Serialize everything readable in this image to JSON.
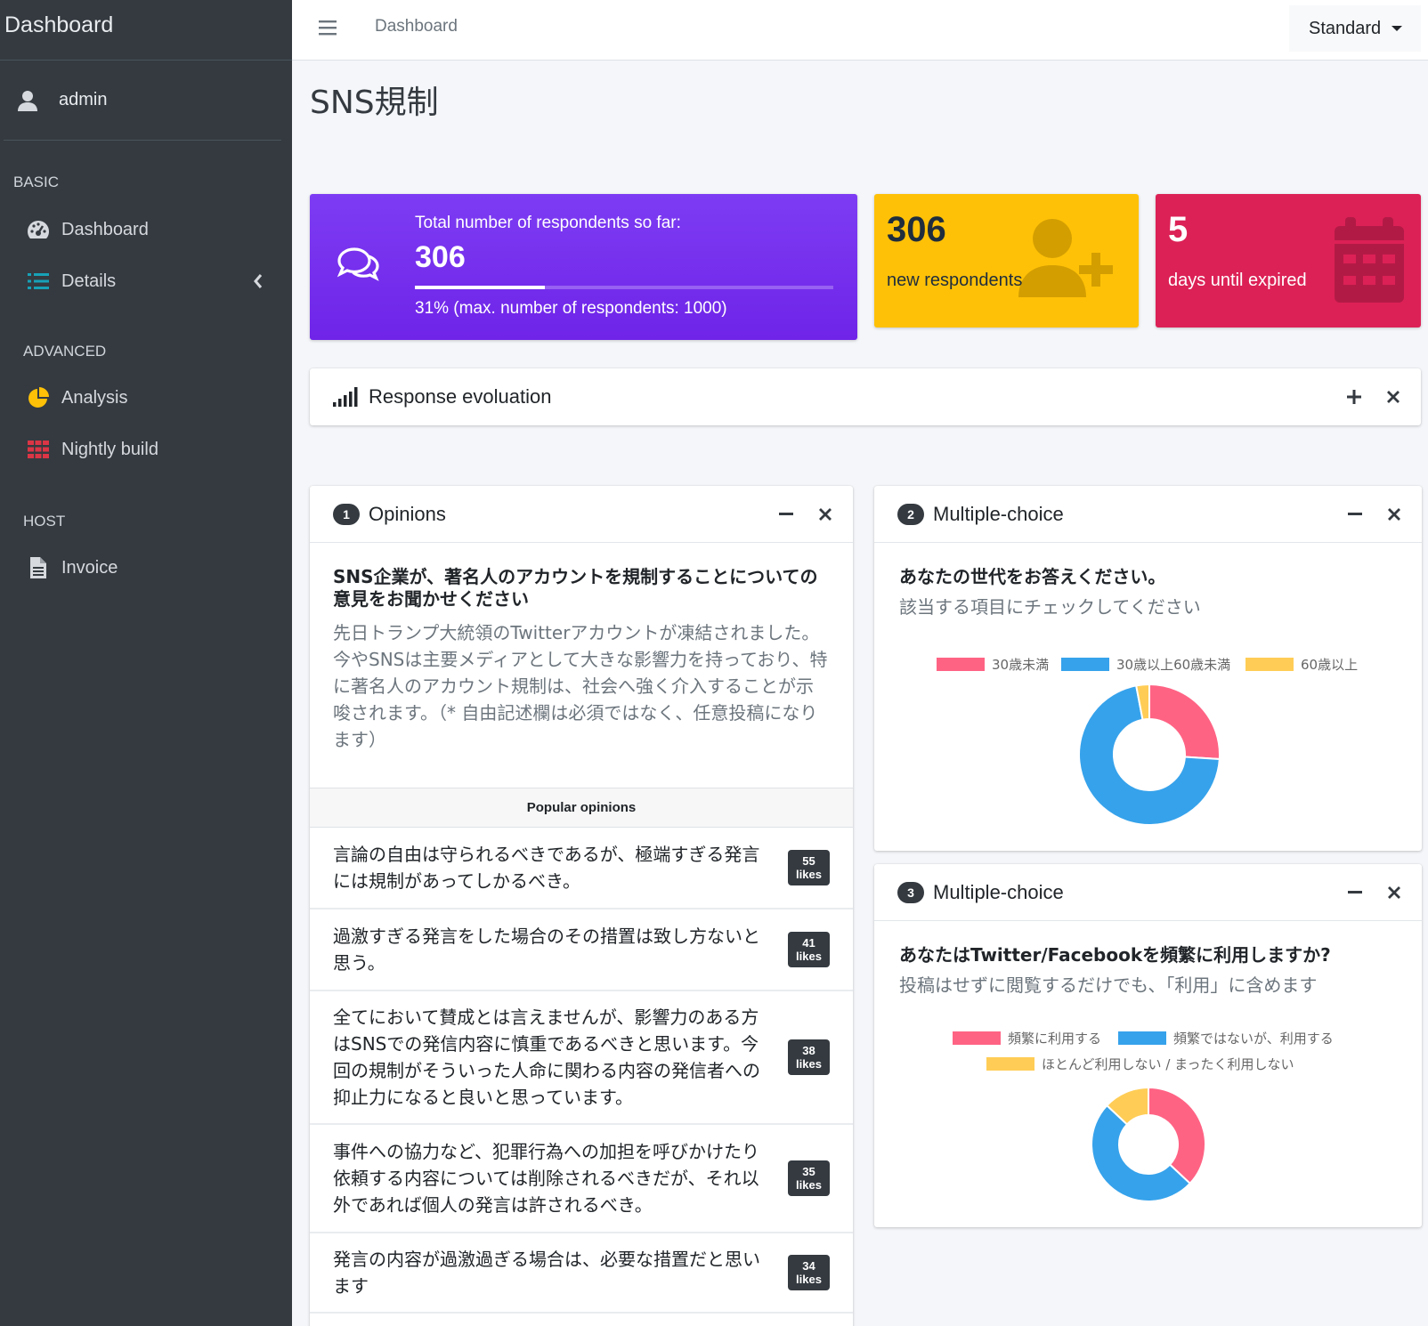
{
  "sidebar": {
    "brand": "Dashboard",
    "user": "admin",
    "sections": [
      {
        "header": "BASIC",
        "items": [
          {
            "label": "Dashboard",
            "icon": "tachometer-icon"
          },
          {
            "label": "Details",
            "icon": "list-icon"
          }
        ]
      },
      {
        "header": "ADVANCED",
        "items": [
          {
            "label": "Analysis",
            "icon": "pie-chart-icon"
          },
          {
            "label": "Nightly build",
            "icon": "grid-icon"
          }
        ]
      },
      {
        "header": "HOST",
        "items": [
          {
            "label": "Invoice",
            "icon": "file-icon"
          }
        ]
      }
    ]
  },
  "topbar": {
    "breadcrumb": "Dashboard",
    "mode": "Standard"
  },
  "page": {
    "title": "SNS規制"
  },
  "stats": {
    "total": {
      "label": "Total number of respondents so far:",
      "value": "306",
      "progress": 0.31,
      "desc": "31% (max. number of respondents: 1000)"
    },
    "new": {
      "value": "306",
      "label": "new respondents",
      "color": "#ffc107"
    },
    "expire": {
      "value": "5",
      "label": "days until expired",
      "color": "#dc2156"
    }
  },
  "response": {
    "title": "Response evoluation"
  },
  "opinions": {
    "num": "1",
    "title": "Opinions",
    "question": "SNS企業が、著名人のアカウントを規制することについての意見をお聞かせください",
    "description": "先日トランプ大統領のTwitterアカウントが凍結されました。今やSNSは主要メディアとして大きな影響力を持っており、特に著名人のアカウント規制は、社会へ強く介入することが示唆されます。（* 自由記述欄は必須ではなく、任意投稿になります）",
    "popular_header": "Popular opinions",
    "likes_label": "likes",
    "items": [
      {
        "text": "言論の自由は守られるべきであるが、極端すぎる発言には規制があってしかるべき。",
        "likes": "55"
      },
      {
        "text": "過激すぎる発言をした場合のその措置は致し方ないと思う。",
        "likes": "41"
      },
      {
        "text": "全てにおいて賛成とは言えませんが、影響力のある方はSNSでの発信内容に慎重であるべきと思います。今回の規制がそういった人命に関わる内容の発信者への抑止力になると良いと思っています。",
        "likes": "38"
      },
      {
        "text": "事件への協力など、犯罪行為への加担を呼びかけたり依頼する内容については削除されるべきだが、それ以外であれば個人の発言は許されるべき。",
        "likes": "35"
      },
      {
        "text": "発言の内容が過激過ぎる場合は、必要な措置だと思います",
        "likes": "34"
      }
    ]
  },
  "mc1": {
    "num": "2",
    "title": "Multiple-choice",
    "question": "あなたの世代をお答えください。",
    "hint": "該当する項目にチェックしてください",
    "chart_data": {
      "type": "pie",
      "categories": [
        "30歳未満",
        "30歳以上60歳未満",
        "60歳以上"
      ],
      "values": [
        26,
        71,
        3
      ],
      "colors": [
        "#ff6384",
        "#36a2eb",
        "#ffcd56"
      ]
    }
  },
  "mc2": {
    "num": "3",
    "title": "Multiple-choice",
    "question": "あなたはTwitter/Facebookを頻繁に利用しますか?",
    "hint": "投稿はせずに閲覧するだけでも、「利用」に含めます",
    "chart_data": {
      "type": "pie",
      "categories": [
        "頻繁に利用する",
        "頻繁ではないが、利用する",
        "ほとんど利用しない / まったく利用しない"
      ],
      "values": [
        37,
        50,
        13
      ],
      "colors": [
        "#ff6384",
        "#36a2eb",
        "#ffcd56"
      ]
    }
  }
}
